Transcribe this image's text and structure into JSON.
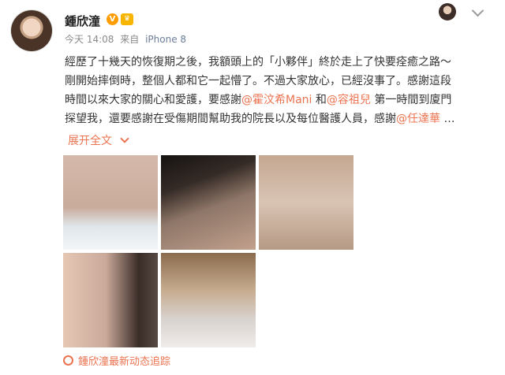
{
  "user": {
    "name": "鍾欣潼",
    "verified_badge": "V"
  },
  "meta": {
    "time": "今天 14:08",
    "source_prefix": "来自",
    "device": "iPhone 8"
  },
  "post": {
    "lines": [
      [
        {
          "text": "經歷了十幾天的恢復期之後，我額頭上的「小夥伴」終於走上了快要痊癒之路～",
          "mention": false
        }
      ],
      [
        {
          "text": "剛開始摔倒時，整個人都和它一起懵了。不過大家放心，已經沒事了。感謝這段",
          "mention": false
        }
      ],
      [
        {
          "text": "時間以來大家的關心和愛護，要感謝",
          "mention": false
        },
        {
          "text": "@霍汶希Mani",
          "mention": true
        },
        {
          "text": " 和",
          "mention": false
        },
        {
          "text": "@容祖兒",
          "mention": true
        },
        {
          "text": " 第一時間到廈門",
          "mention": false
        }
      ],
      [
        {
          "text": "探望我，還要感謝在受傷期間幫助我的院長以及每位醫護人員，感謝",
          "mention": false
        },
        {
          "text": "@任達華",
          "mention": true
        },
        {
          "text": " …",
          "mention": false
        }
      ]
    ],
    "expand_label": "展开全文"
  },
  "photos": [
    {
      "alt": "photo-1"
    },
    {
      "alt": "photo-2"
    },
    {
      "alt": "photo-3"
    },
    {
      "alt": "photo-4"
    },
    {
      "alt": "photo-5"
    }
  ],
  "footer": {
    "text": "鍾欣潼最新动态追踪"
  },
  "colors": {
    "accent": "#eb7350",
    "device": "#6c7d9a",
    "text": "#333333",
    "muted": "#8a8a8a"
  }
}
